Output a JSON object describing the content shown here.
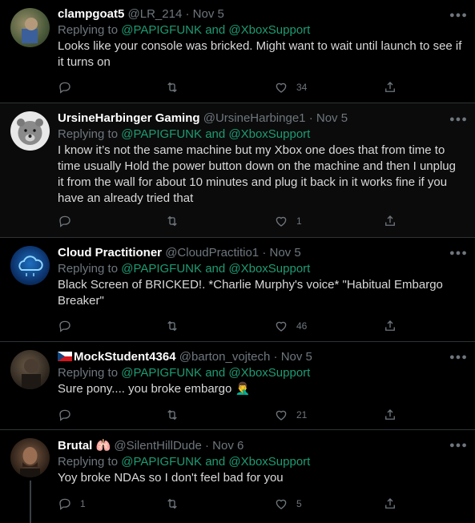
{
  "replying_label": "Replying to",
  "and_label": "and",
  "tweets": [
    {
      "name": "clampgoat5",
      "handle": "@LR_214",
      "date": "Nov 5",
      "mentions": [
        "@PAPIGFUNK",
        "@XboxSupport"
      ],
      "text": "Looks like your console was bricked. Might want to wait until launch to see if it turns on",
      "counts": {
        "reply": "",
        "retweet": "",
        "like": "34"
      }
    },
    {
      "name": "UrsineHarbinger Gaming",
      "handle": "@UrsineHarbinge1",
      "date": "Nov 5",
      "mentions": [
        "@PAPIGFUNK",
        "@XboxSupport"
      ],
      "text": "I know it’s not the same machine but my Xbox one does that from time to time usually Hold the power button down on the machine and then I unplug it from the wall for about 10 minutes and plug it back in it works fine if you have an already tried that",
      "counts": {
        "reply": "",
        "retweet": "",
        "like": "1"
      }
    },
    {
      "name": "Cloud Practitioner",
      "handle": "@CloudPractitio1",
      "date": "Nov 5",
      "mentions": [
        "@PAPIGFUNK",
        "@XboxSupport"
      ],
      "text": "Black Screen of BRICKED!. *Charlie Murphy's voice*  \"Habitual Embargo Breaker\"",
      "counts": {
        "reply": "",
        "retweet": "",
        "like": "46"
      }
    },
    {
      "name": "MockStudent4364",
      "handle": "@barton_vojtech",
      "date": "Nov 5",
      "mentions": [
        "@PAPIGFUNK",
        "@XboxSupport"
      ],
      "text": "Sure pony.... you broke embargo 🤦‍♂️",
      "counts": {
        "reply": "",
        "retweet": "",
        "like": "21"
      }
    },
    {
      "name": "Brutal 🫁",
      "handle": "@SilentHillDude",
      "date": "Nov 6",
      "mentions": [
        "@PAPIGFUNK",
        "@XboxSupport"
      ],
      "text": "Yoy broke NDAs so I don't feel bad for you",
      "counts": {
        "reply": "1",
        "retweet": "",
        "like": "5"
      }
    }
  ],
  "icons": {
    "reply": "reply-icon",
    "retweet": "retweet-icon",
    "like": "heart-icon",
    "share": "share-icon",
    "more": "more-icon"
  },
  "colors": {
    "mention": "#1d9b73",
    "muted": "#6e767d",
    "background": "#000000"
  }
}
